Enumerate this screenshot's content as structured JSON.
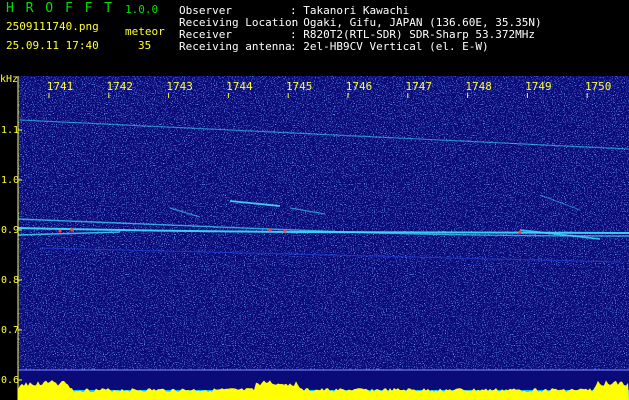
{
  "header": {
    "app_name": "H R O F F T",
    "version": "1.0.0",
    "filename": "2509111740.png",
    "datetime": "25.09.11 17:40",
    "meteor_label": "meteor",
    "meteor_count": "35"
  },
  "info": {
    "rows": [
      {
        "label": "Observer",
        "value": ": Takanori Kawachi"
      },
      {
        "label": "Receiving Location",
        "value": ": Ogaki, Gifu, JAPAN (136.60E, 35.35N)"
      },
      {
        "label": "Receiver",
        "value": ": R820T2(RTL-SDR) SDR-Sharp 53.372MHz"
      },
      {
        "label": "Receiving antenna",
        "value": ": 2el-HB9CV Vertical (el. E-W)"
      }
    ]
  },
  "spectrogram": {
    "y_unit": "kHz",
    "time_ticks": [
      "1741",
      "1742",
      "1743",
      "1744",
      "1745",
      "1746",
      "1747",
      "1748",
      "1749",
      "1750"
    ],
    "freq_ticks": [
      "1.1",
      "1.0",
      "0.9",
      "0.8",
      "0.7",
      "0.6"
    ],
    "colors": {
      "background": "#0a0a78",
      "noise": "#2040d8",
      "trace": "#40e0ff",
      "hot": "#ff4040",
      "axis_text": "#ffff33",
      "info_text": "#ffffff",
      "title_text": "#00e000",
      "level_bar": "#ffff00",
      "level_floor": "#00c0ff"
    }
  }
}
